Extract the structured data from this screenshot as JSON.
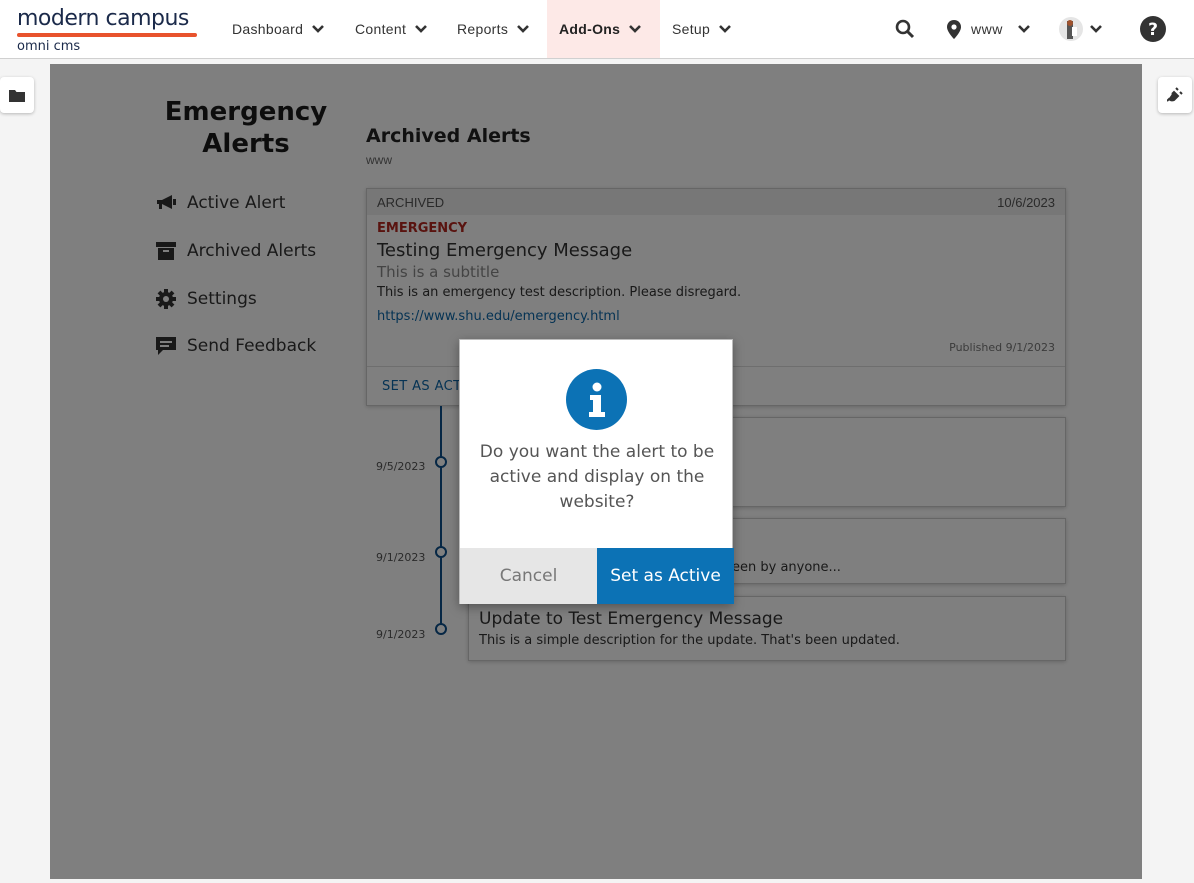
{
  "brand": {
    "name_top": "modern campus",
    "name_bottom": "omni cms",
    "accent": "#e8532d"
  },
  "nav": {
    "items": [
      {
        "label": "Dashboard"
      },
      {
        "label": "Content"
      },
      {
        "label": "Reports"
      },
      {
        "label": "Add-Ons",
        "active": true
      },
      {
        "label": "Setup"
      }
    ],
    "site": "www",
    "icons": [
      "search-icon",
      "map-marker-icon",
      "avatar",
      "help-icon"
    ]
  },
  "side_tabs": {
    "left": "folder-icon",
    "right": "plug-icon"
  },
  "app": {
    "title_line1": "Emergency",
    "title_line2": "Alerts",
    "menu": [
      {
        "label": "Active Alert",
        "icon": "bullhorn-icon"
      },
      {
        "label": "Archived Alerts",
        "icon": "archive-icon"
      },
      {
        "label": "Settings",
        "icon": "gear-icon"
      },
      {
        "label": "Send Feedback",
        "icon": "comment-icon"
      }
    ]
  },
  "section": {
    "title": "Archived Alerts",
    "subtitle": "www"
  },
  "card": {
    "status": "ARCHIVED",
    "date": "10/6/2023",
    "tag": "EMERGENCY",
    "title": "Testing Emergency Message",
    "subtitle": "This is a subtitle",
    "description": "This is an emergency test description. Please disregard.",
    "link": "https://www.shu.edu/emergency.html",
    "published": "Published 9/1/2023",
    "action": "SET AS ACTI"
  },
  "timeline": {
    "dates": [
      "9/5/2023",
      "9/1/2023",
      "9/1/2023"
    ],
    "partial_text": "een by anyone...",
    "update": {
      "title": "Update to Test Emergency Message",
      "description": "This is a simple description for the update. That's been updated."
    }
  },
  "modal": {
    "message": "Do you want the alert to be active and display on the website?",
    "cancel": "Cancel",
    "confirm": "Set as Active",
    "accent": "#0c72b5"
  }
}
